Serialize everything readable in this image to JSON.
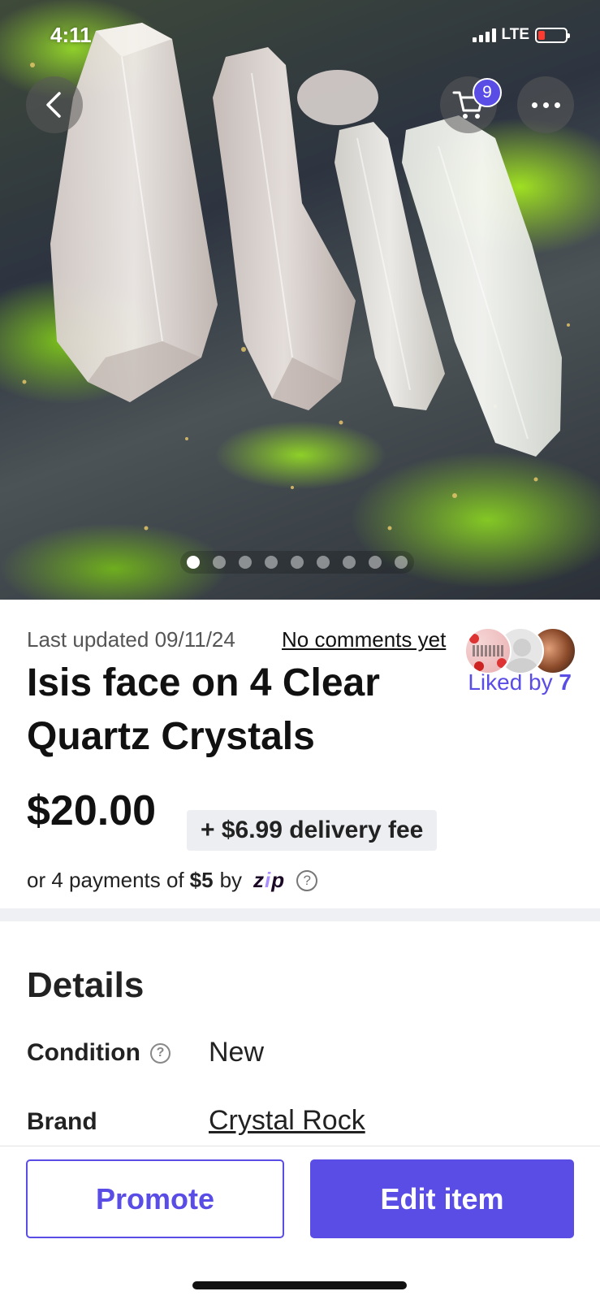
{
  "status_bar": {
    "time": "4:11",
    "network": "LTE"
  },
  "cart": {
    "badge_count": "9"
  },
  "gallery": {
    "image_count": 9,
    "active_index": 0
  },
  "listing": {
    "last_updated": "Last updated 09/11/24",
    "comments_link": "No comments yet",
    "title": "Isis face on 4 Clear Quartz Crystals",
    "liked_by_prefix": "Liked by ",
    "liked_by_count": "7",
    "price": "$20.00",
    "delivery_fee": "+ $6.99 delivery fee",
    "payments_prefix": "or 4 payments of",
    "payments_amount": "$5",
    "payments_suffix": "by",
    "zip_logo": "zip"
  },
  "details": {
    "heading": "Details",
    "condition_label": "Condition",
    "condition_value": "New",
    "brand_label": "Brand",
    "brand_value": "Crystal Rock"
  },
  "actions": {
    "promote_label": "Promote",
    "edit_label": "Edit item"
  },
  "colors": {
    "accent": "#5a4de6",
    "fee_bg": "#eceef2",
    "divider": "#eef0f3"
  },
  "icons": [
    "back-chevron-icon",
    "cart-icon",
    "more-dots-icon",
    "help-circle-icon",
    "signal-icon",
    "battery-icon"
  ]
}
